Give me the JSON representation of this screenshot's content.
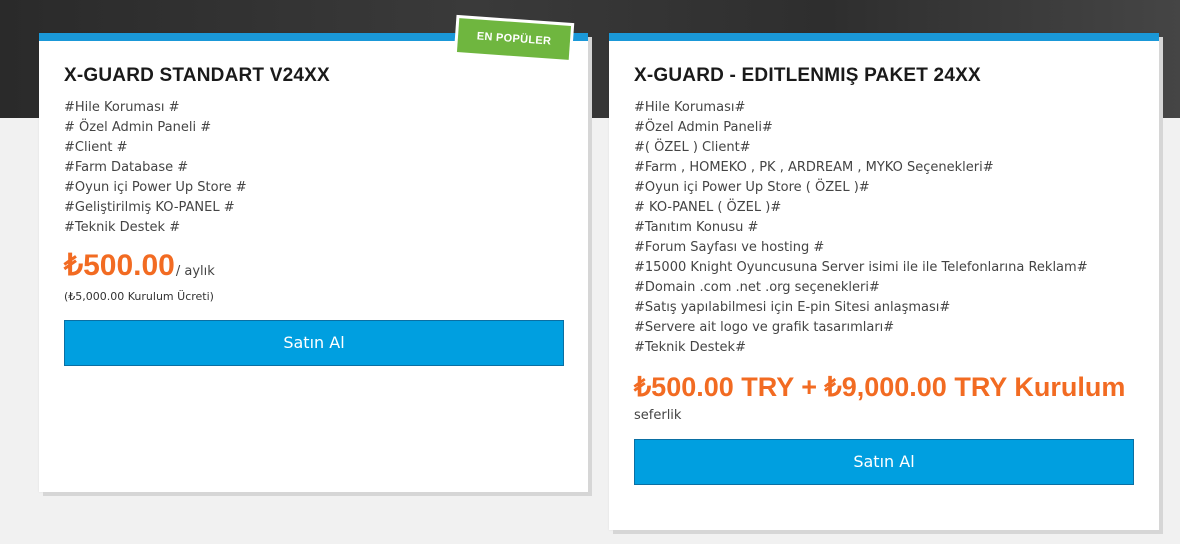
{
  "colors": {
    "accent_blue": "#1a98d8",
    "button_blue": "#009fe0",
    "price_orange": "#f26b22",
    "badge_green": "#6fb63f"
  },
  "plans": [
    {
      "title": "X-GUARD STANDART V24XX",
      "badge": "EN POPÜLER",
      "features": [
        "#Hile Koruması #",
        "# Özel Admin Paneli #",
        "#Client #",
        "#Farm Database #",
        "#Oyun içi Power Up Store #",
        "#Geliştirilmiş KO-PANEL #",
        "#Teknik Destek #"
      ],
      "price": "₺500.00",
      "period": "/ aylık",
      "setup_fee": "(₺5,000.00 Kurulum Ücreti)",
      "button_label": "Satın Al"
    },
    {
      "title": "X-GUARD - EDITLENMIŞ PAKET 24XX",
      "features": [
        "#Hile Koruması#",
        "#Özel Admin Paneli#",
        "#( ÖZEL ) Client#",
        "#Farm , HOMEKO , PK , ARDREAM , MYKO Seçenekleri#",
        "#Oyun içi Power Up Store ( ÖZEL )#",
        "# KO-PANEL ( ÖZEL )#",
        "#Tanıtım Konusu #",
        "#Forum Sayfası ve hosting #",
        "#15000 Knight Oyuncusuna Server isimi ile ile Telefonlarına Reklam#",
        "#Domain .com .net .org seçenekleri#",
        "#Satış yapılabilmesi için E-pin Sitesi anlaşması#",
        "#Servere ait logo ve grafik tasarımları#",
        "#Teknik Destek#"
      ],
      "price": "₺500.00 TRY + ₺9,000.00 TRY Kurulum",
      "period": "seferlik",
      "button_label": "Satın Al"
    }
  ]
}
